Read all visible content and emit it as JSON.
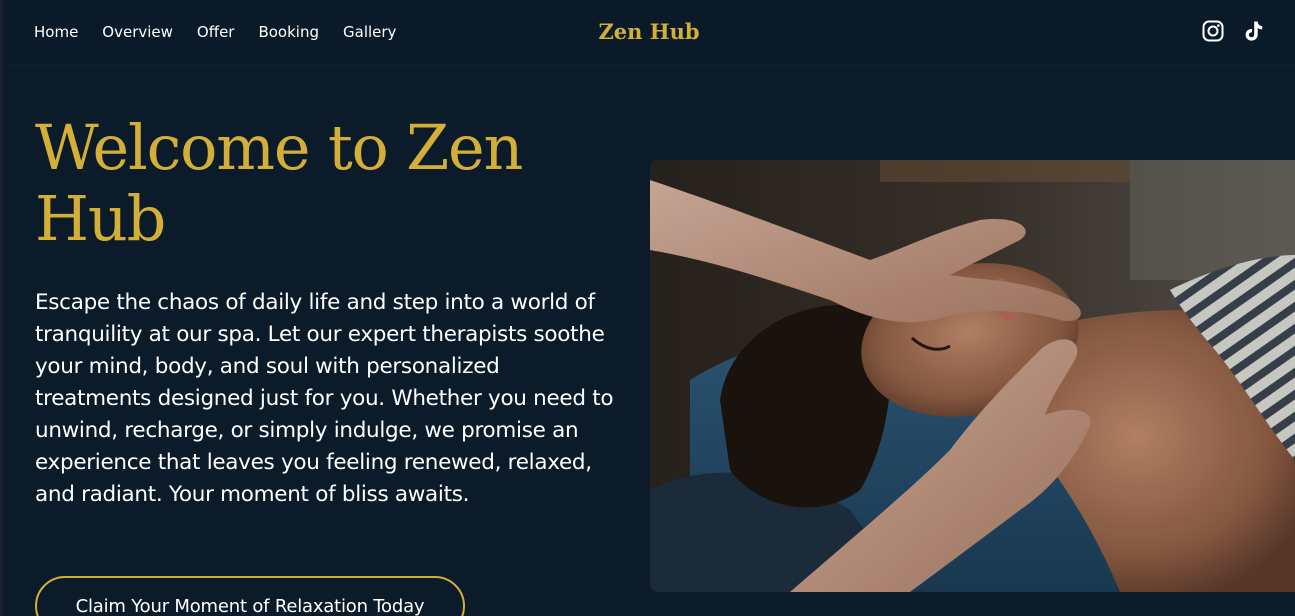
{
  "nav": {
    "links": [
      {
        "label": "Home"
      },
      {
        "label": "Overview"
      },
      {
        "label": "Offer"
      },
      {
        "label": "Booking"
      },
      {
        "label": "Gallery"
      }
    ],
    "brand": "Zen Hub",
    "social": [
      {
        "icon": "instagram-icon"
      },
      {
        "icon": "tiktok-icon"
      }
    ]
  },
  "hero": {
    "title": "Welcome to Zen Hub",
    "description": "Escape the chaos of daily life and step into a world of tranquility at our spa. Let our expert therapists soothe your mind, body, and soul with personalized treatments designed just for you. Whether you need to unwind, recharge, or simply indulge, we promise an experience that leaves you feeling renewed, relaxed, and radiant. Your moment of bliss awaits.",
    "cta_label": "Claim Your Moment of Relaxation Today",
    "image_subject": "facial-massage-photo"
  },
  "colors": {
    "background": "#0b1b2a",
    "nav_background": "#0a1a28",
    "accent_gold": "#d4af37",
    "text": "#ffffff"
  }
}
